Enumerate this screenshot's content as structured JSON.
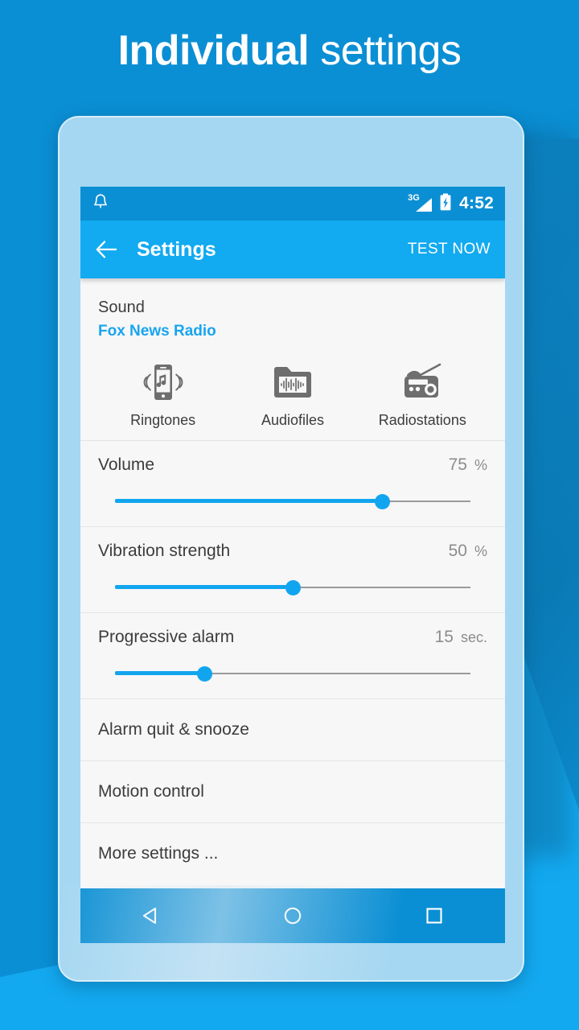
{
  "headline": {
    "bold": "Individual",
    "light": "settings"
  },
  "colors": {
    "background": "#0b8fd4",
    "background_accent": "#13a9f0",
    "app_bar": "#12aaf0",
    "status_bar": "#0b8fd4",
    "accent": "#12a5ef",
    "phone_frame": "#a5d7f2",
    "screen": "#f7f7f7",
    "text_primary": "#3c3c3c",
    "text_muted": "#8c8c8c"
  },
  "status_bar": {
    "notification_icon": "bell-icon",
    "network": "3G",
    "signal_icon": "signal-bars-icon",
    "battery_icon": "battery-charging-icon",
    "clock": "4:52"
  },
  "app_bar": {
    "back_icon": "back-arrow-icon",
    "title": "Settings",
    "action": "TEST NOW"
  },
  "sound": {
    "title": "Sound",
    "value": "Fox News Radio",
    "sources": [
      {
        "label": "Ringtones",
        "icon": "phone-music-icon"
      },
      {
        "label": "Audiofiles",
        "icon": "folder-waveform-icon"
      },
      {
        "label": "Radiostations",
        "icon": "radio-icon"
      }
    ]
  },
  "sliders": [
    {
      "label": "Volume",
      "value": "75",
      "unit": "%",
      "percent": 75
    },
    {
      "label": "Vibration strength",
      "value": "50",
      "unit": "%",
      "percent": 50
    },
    {
      "label": "Progressive alarm",
      "value": "15",
      "unit": "sec.",
      "percent": 25
    }
  ],
  "menu": [
    {
      "label": "Alarm quit & snooze"
    },
    {
      "label": "Motion control"
    },
    {
      "label": "More settings ..."
    }
  ],
  "nav_bar": {
    "back": "nav-back-icon",
    "home": "nav-home-icon",
    "recents": "nav-recents-icon"
  }
}
